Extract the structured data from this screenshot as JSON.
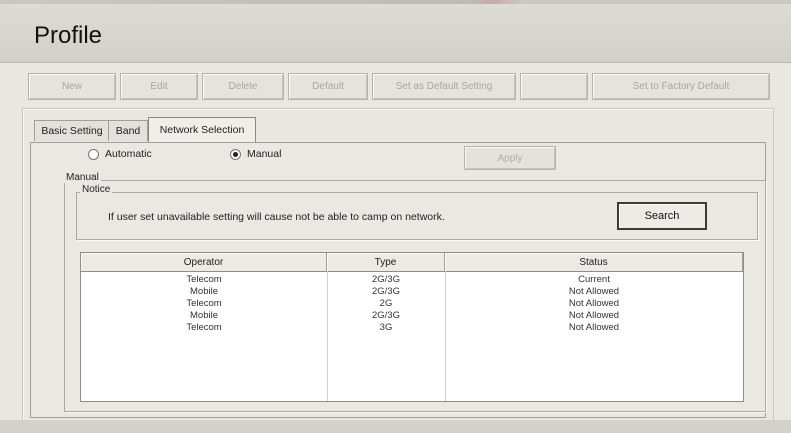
{
  "window": {
    "title": "Profile"
  },
  "toolbar": {
    "buttons": [
      "New",
      "Edit",
      "Delete",
      "Default",
      "Set as Default Setting",
      "",
      "Set to Factory Default"
    ]
  },
  "tabs": [
    "Basic Setting",
    "Band",
    "Network Selection"
  ],
  "network_selection": {
    "mode_automatic_label": "Automatic",
    "mode_manual_label": "Manual",
    "selected_mode": "Manual",
    "apply_label": "Apply",
    "manual_group_label": "Manual",
    "notice_group_label": "Notice",
    "notice_text": "If user set unavailable setting will cause not be able to camp on network.",
    "search_label": "Search"
  },
  "table": {
    "columns": [
      "Operator",
      "Type",
      "Status"
    ],
    "rows": [
      {
        "operator": "Telecom",
        "type": "2G/3G",
        "status": "Current"
      },
      {
        "operator": "Mobile",
        "type": "2G/3G",
        "status": "Not Allowed"
      },
      {
        "operator": "Telecom",
        "type": "2G",
        "status": "Not Allowed"
      },
      {
        "operator": "Mobile",
        "type": "2G/3G",
        "status": "Not Allowed"
      },
      {
        "operator": "Telecom",
        "type": "3G",
        "status": "Not Allowed"
      }
    ]
  }
}
